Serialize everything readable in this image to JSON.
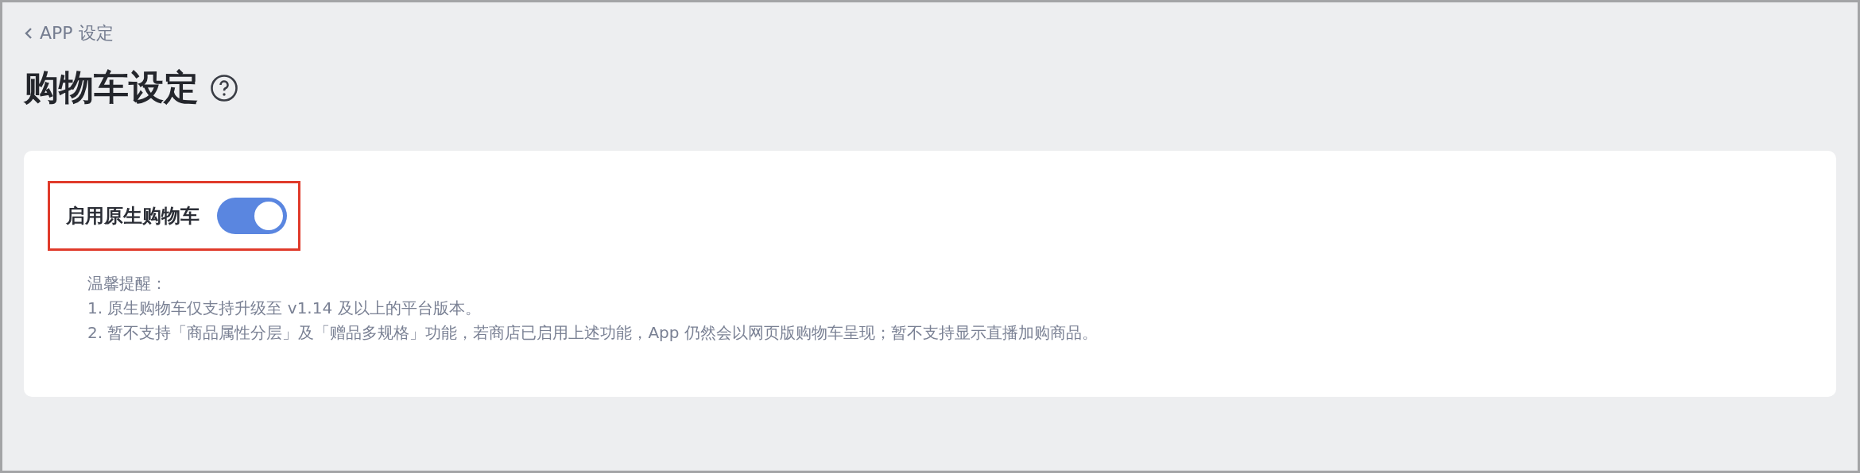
{
  "back_link": {
    "label": "APP 设定"
  },
  "page_title": "购物车设定",
  "setting": {
    "label": "启用原生购物车",
    "on": true,
    "highlighted": true
  },
  "notes": [
    "温馨提醒：",
    "1. 原生购物车仅支持升级至 v1.14 及以上的平台版本。",
    "2. 暂不支持「商品属性分层」及「赠品多规格」功能，若商店已启用上述功能，App 仍然会以网页版购物车呈现；暂不支持显示直播加购商品。"
  ]
}
